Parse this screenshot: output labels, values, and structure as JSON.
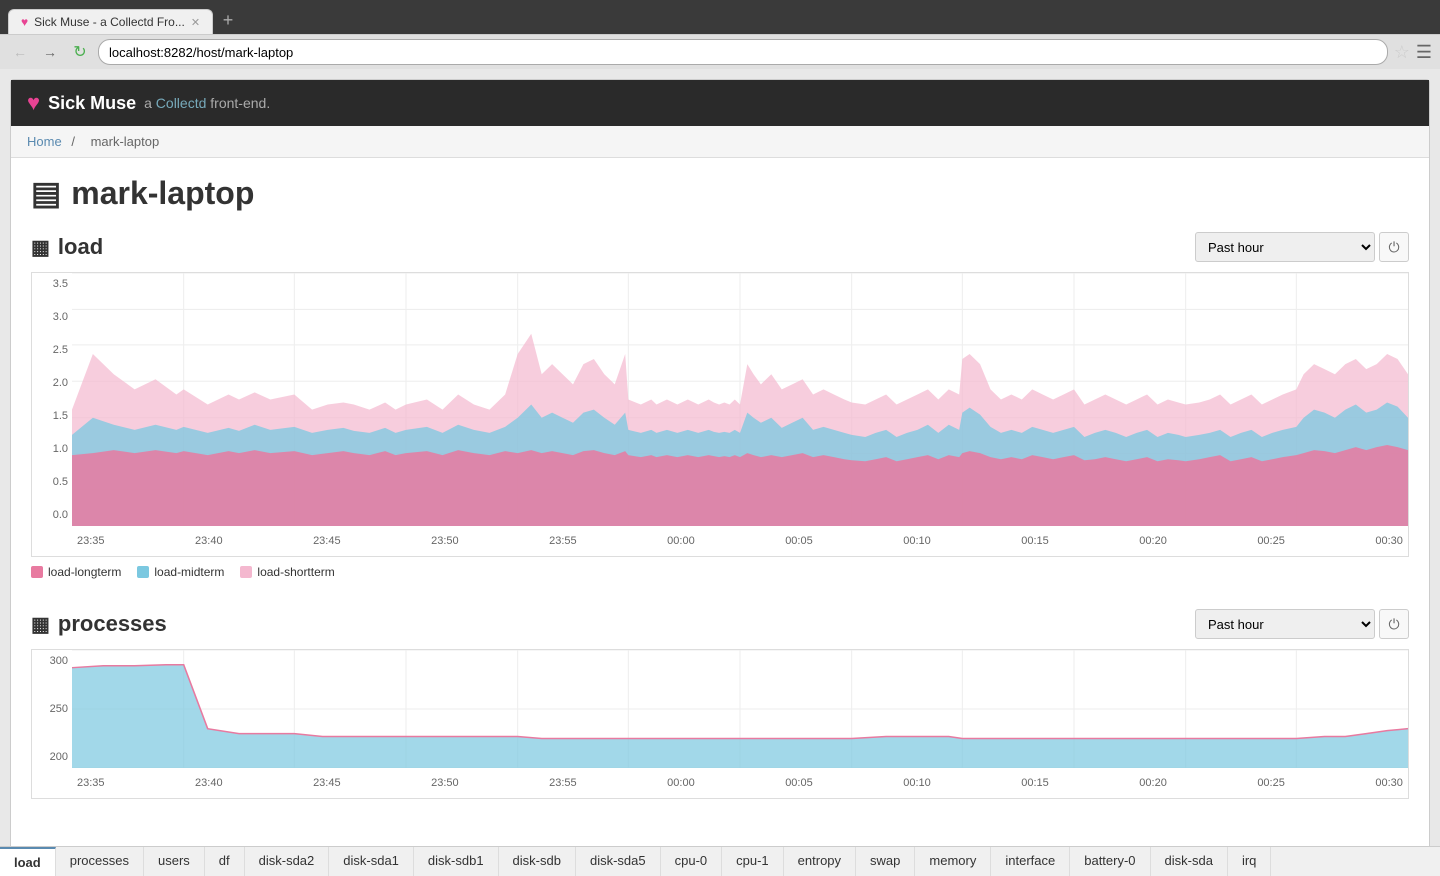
{
  "browser": {
    "tab_title": "Sick Muse - a Collectd Fro...",
    "url": "localhost:8282/host/mark-laptop",
    "favicon": "♥"
  },
  "app": {
    "logo": "♥",
    "title": "Sick Muse",
    "subtitle_prefix": "a",
    "subtitle_link": "Collectd",
    "subtitle_suffix": "front-end."
  },
  "breadcrumb": {
    "home": "Home",
    "separator": "/",
    "current": "mark-laptop"
  },
  "host": {
    "icon": "🖥",
    "name": "mark-laptop"
  },
  "load_chart": {
    "title": "load",
    "time_label": "Past hour",
    "y_labels": [
      "3.5",
      "3.0",
      "2.5",
      "2.0",
      "1.5",
      "1.0",
      "0.5",
      "0.0"
    ],
    "x_labels": [
      "23:35",
      "23:40",
      "23:45",
      "23:50",
      "23:55",
      "00:00",
      "00:05",
      "00:10",
      "00:15",
      "00:20",
      "00:25",
      "00:30"
    ],
    "legend": [
      {
        "key": "load-longterm",
        "label": "load-longterm",
        "color": "#e87aa0"
      },
      {
        "key": "load-midterm",
        "label": "load-midterm",
        "color": "#7bc8e0"
      },
      {
        "key": "load-shortterm",
        "label": "load-shortterm",
        "color": "#f4b8cf"
      }
    ]
  },
  "processes_chart": {
    "title": "processes",
    "time_label": "Past hour",
    "y_labels": [
      "300",
      "250",
      "200"
    ],
    "x_labels": [
      "23:35",
      "23:40",
      "23:45",
      "23:50",
      "23:55",
      "00:00",
      "00:05",
      "00:10",
      "00:15",
      "00:20",
      "00:25",
      "00:30"
    ]
  },
  "bottom_tabs": [
    {
      "label": "load",
      "active": true
    },
    {
      "label": "processes",
      "active": false
    },
    {
      "label": "users",
      "active": false
    },
    {
      "label": "df",
      "active": false
    },
    {
      "label": "disk-sda2",
      "active": false
    },
    {
      "label": "disk-sda1",
      "active": false
    },
    {
      "label": "disk-sdb1",
      "active": false
    },
    {
      "label": "disk-sdb",
      "active": false
    },
    {
      "label": "disk-sda5",
      "active": false
    },
    {
      "label": "cpu-0",
      "active": false
    },
    {
      "label": "cpu-1",
      "active": false
    },
    {
      "label": "entropy",
      "active": false
    },
    {
      "label": "swap",
      "active": false
    },
    {
      "label": "memory",
      "active": false
    },
    {
      "label": "interface",
      "active": false
    },
    {
      "label": "battery-0",
      "active": false
    },
    {
      "label": "disk-sda",
      "active": false
    },
    {
      "label": "irq",
      "active": false
    }
  ]
}
